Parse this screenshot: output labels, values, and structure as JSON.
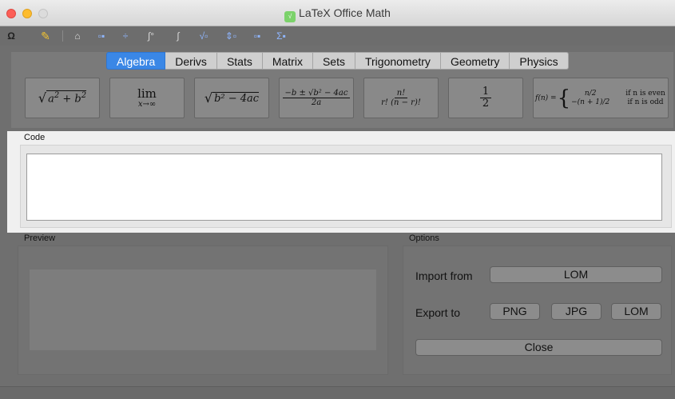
{
  "window": {
    "title": "LaTeX Office Math",
    "app_icon": "lom-app-icon",
    "controls": [
      "close",
      "minimize",
      "zoom"
    ]
  },
  "toolbar": {
    "items": [
      {
        "name": "omega-symbol-icon",
        "glyph": "Ω"
      },
      {
        "name": "pencil-icon",
        "glyph": "✎"
      },
      {
        "name": "accent-hat-icon",
        "glyph": "⌂"
      },
      {
        "name": "superscript-icon",
        "glyph": "▫▪"
      },
      {
        "name": "fraction-icon",
        "glyph": "÷"
      },
      {
        "name": "integral-limits-icon",
        "glyph": "∫°"
      },
      {
        "name": "integral-icon",
        "glyph": "∫"
      },
      {
        "name": "root-icon",
        "glyph": "√▫"
      },
      {
        "name": "arrows-icon",
        "glyph": "⇕▫"
      },
      {
        "name": "subscript-icon",
        "glyph": "▫▪"
      },
      {
        "name": "sum-matrix-icon",
        "glyph": "Σ▪"
      }
    ]
  },
  "tabs": [
    {
      "label": "Algebra",
      "active": true
    },
    {
      "label": "Derivs",
      "active": false
    },
    {
      "label": "Stats",
      "active": false
    },
    {
      "label": "Matrix",
      "active": false
    },
    {
      "label": "Sets",
      "active": false
    },
    {
      "label": "Trigonometry",
      "active": false
    },
    {
      "label": "Geometry",
      "active": false
    },
    {
      "label": "Physics",
      "active": false
    }
  ],
  "formulas": {
    "pythagoras": {
      "a": "a",
      "b": "b",
      "exp": "2"
    },
    "limit": {
      "op": "lim",
      "sub": "x→∞"
    },
    "discriminant": {
      "body": "b² − 4ac"
    },
    "quadratic": {
      "numerator": "−b ± √b² − 4ac",
      "denominator": "2a"
    },
    "combination": {
      "numerator": "n!",
      "denominator": "r! (n − r)!"
    },
    "half": {
      "numerator": "1",
      "denominator": "2"
    },
    "piecewise": {
      "lhs": "f(n) =",
      "case1": "n/2",
      "cond1": "if n is even",
      "case2": "−(n + 1)/2",
      "cond2": "if n is odd"
    }
  },
  "code": {
    "label": "Code",
    "value": ""
  },
  "preview": {
    "label": "Preview"
  },
  "options": {
    "label": "Options",
    "import_label": "Import from",
    "import_button": "LOM",
    "export_label": "Export to",
    "export_buttons": [
      "PNG",
      "JPG",
      "LOM"
    ],
    "close_button": "Close"
  },
  "colors": {
    "accent": "#3a87e6",
    "close_light": "#fc5f57",
    "minimize_light": "#fdbc2e",
    "zoom_light": "#dcdcdc"
  }
}
